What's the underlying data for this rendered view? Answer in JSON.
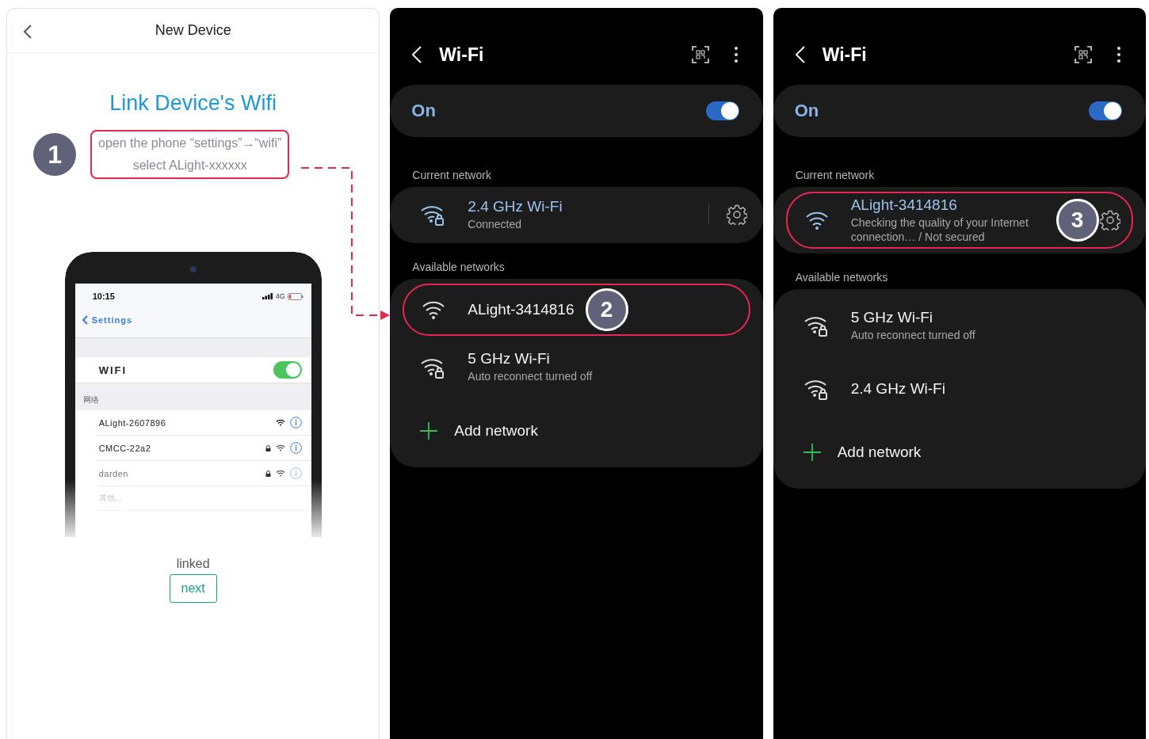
{
  "setup_screen": {
    "title": "New Device",
    "heading": "Link Device's Wifi",
    "step_number": "1",
    "instruction_lines": [
      "open the phone “settings”→“wifi”",
      "select ALight-xxxxxx"
    ],
    "phone": {
      "time": "10:15",
      "network_type": "4G",
      "back_label": "Settings",
      "wifi_label": "WIFI",
      "wifi_on": true,
      "section_label": "网络",
      "networks": [
        {
          "name": "ALight-2607896",
          "locked": false,
          "dimmed": false
        },
        {
          "name": "CMCC-22a2",
          "locked": true,
          "dimmed": false
        },
        {
          "name": "darden",
          "locked": true,
          "dimmed": true
        }
      ],
      "other_label": "其他..."
    },
    "status_text": "linked",
    "next_button": "next"
  },
  "wifi_screens": [
    {
      "title": "Wi-Fi",
      "on_label": "On",
      "wifi_on": true,
      "current_label": "Current network",
      "current": {
        "name": "2.4 GHz Wi-Fi",
        "status": "Connected",
        "kind": "secured",
        "highlighted": false,
        "settings_divider": true
      },
      "available_label": "Available networks",
      "available": [
        {
          "name": "ALight-3414816",
          "kind": "open",
          "highlighted": true,
          "step_number": "2"
        },
        {
          "name": "5 GHz Wi-Fi",
          "status": "Auto reconnect turned off",
          "kind": "secured",
          "highlighted": false
        }
      ],
      "add_label": "Add network"
    },
    {
      "title": "Wi-Fi",
      "on_label": "On",
      "wifi_on": true,
      "current_label": "Current network",
      "current": {
        "name": "ALight-3414816",
        "status": "Checking the quality of your Internet connection… / Not secured",
        "kind": "open",
        "highlighted": true,
        "step_number": "3",
        "settings_divider": false
      },
      "available_label": "Available networks",
      "available": [
        {
          "name": "5 GHz Wi-Fi",
          "status": "Auto reconnect turned off",
          "kind": "secured",
          "highlighted": false
        },
        {
          "name": "2.4 GHz Wi-Fi",
          "kind": "secured",
          "highlighted": false
        }
      ],
      "add_label": "Add network"
    }
  ]
}
